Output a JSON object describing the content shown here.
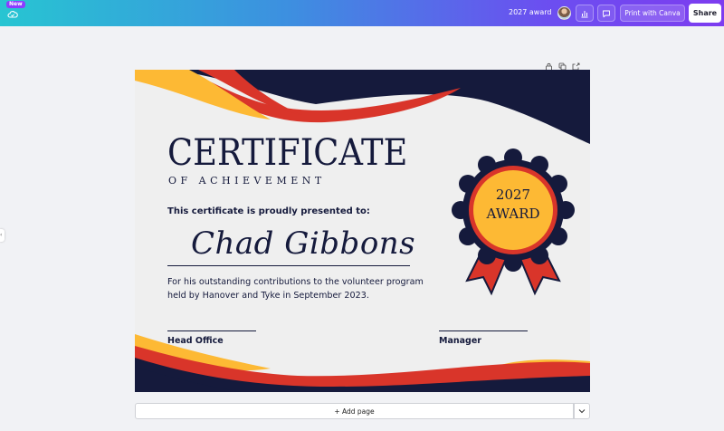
{
  "topbar": {
    "new_badge": "New",
    "doc_title": "2027 award",
    "print_label": "Print with Canva",
    "share_label": "Share"
  },
  "certificate": {
    "title": "CERTIFICATE",
    "subtitle": "OF ACHIEVEMENT",
    "presented": "This certificate is proudly presented to:",
    "recipient": "Chad Gibbons",
    "body": "For his outstanding contributions to the volunteer program held by Hanover and Tyke in September 2023.",
    "signature_left": "Head Office",
    "signature_right": "Manager",
    "badge_year": "2027",
    "badge_word": "AWARD"
  },
  "footer": {
    "add_page_label": "+ Add page"
  },
  "colors": {
    "navy": "#151a3c",
    "red": "#d9352a",
    "gold": "#fdb934"
  }
}
